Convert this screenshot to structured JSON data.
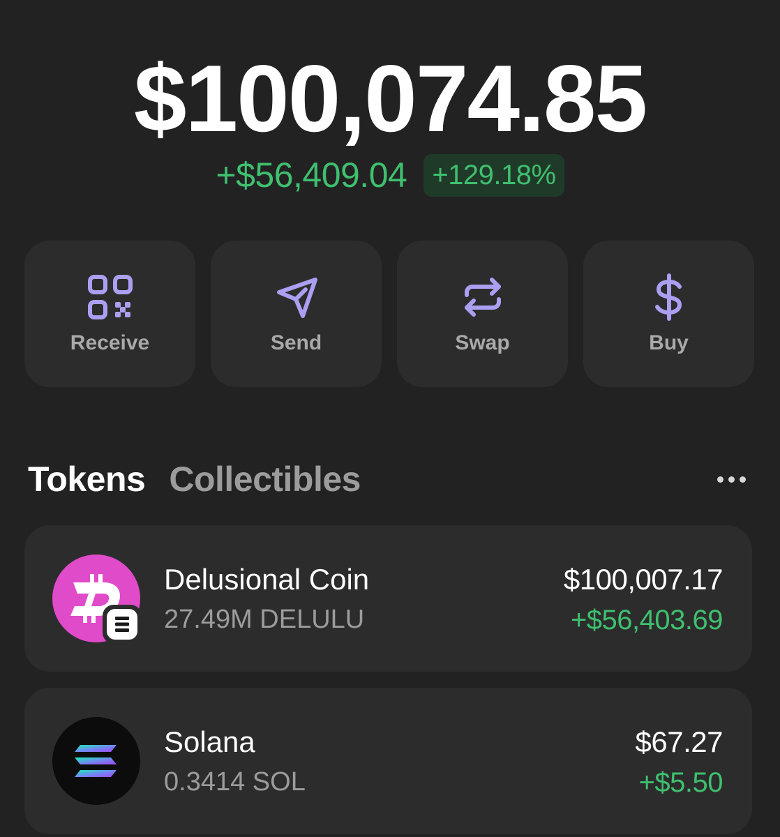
{
  "portfolio": {
    "balance": "$100,074.85",
    "change_amount": "+$56,409.04",
    "change_percent": "+129.18%"
  },
  "actions": [
    {
      "label": "Receive",
      "icon": "qr-code-icon"
    },
    {
      "label": "Send",
      "icon": "send-icon"
    },
    {
      "label": "Swap",
      "icon": "swap-icon"
    },
    {
      "label": "Buy",
      "icon": "dollar-icon"
    }
  ],
  "tabs": [
    {
      "label": "Tokens",
      "active": true
    },
    {
      "label": "Collectibles",
      "active": false
    }
  ],
  "tokens": [
    {
      "name": "Delusional Coin",
      "amount": "27.49M DELULU",
      "value": "$100,007.17",
      "change": "+$56,403.69",
      "icon": "delulu-coin-icon"
    },
    {
      "name": "Solana",
      "amount": "0.3414 SOL",
      "value": "$67.27",
      "change": "+$5.50",
      "icon": "solana-icon"
    }
  ],
  "colors": {
    "background": "#222222",
    "card": "#2c2c2c",
    "accent_purple": "#ab9ff2",
    "positive_green": "#3fc06f",
    "badge_green_bg": "#203a29",
    "delulu_pink": "#e04bc9"
  }
}
